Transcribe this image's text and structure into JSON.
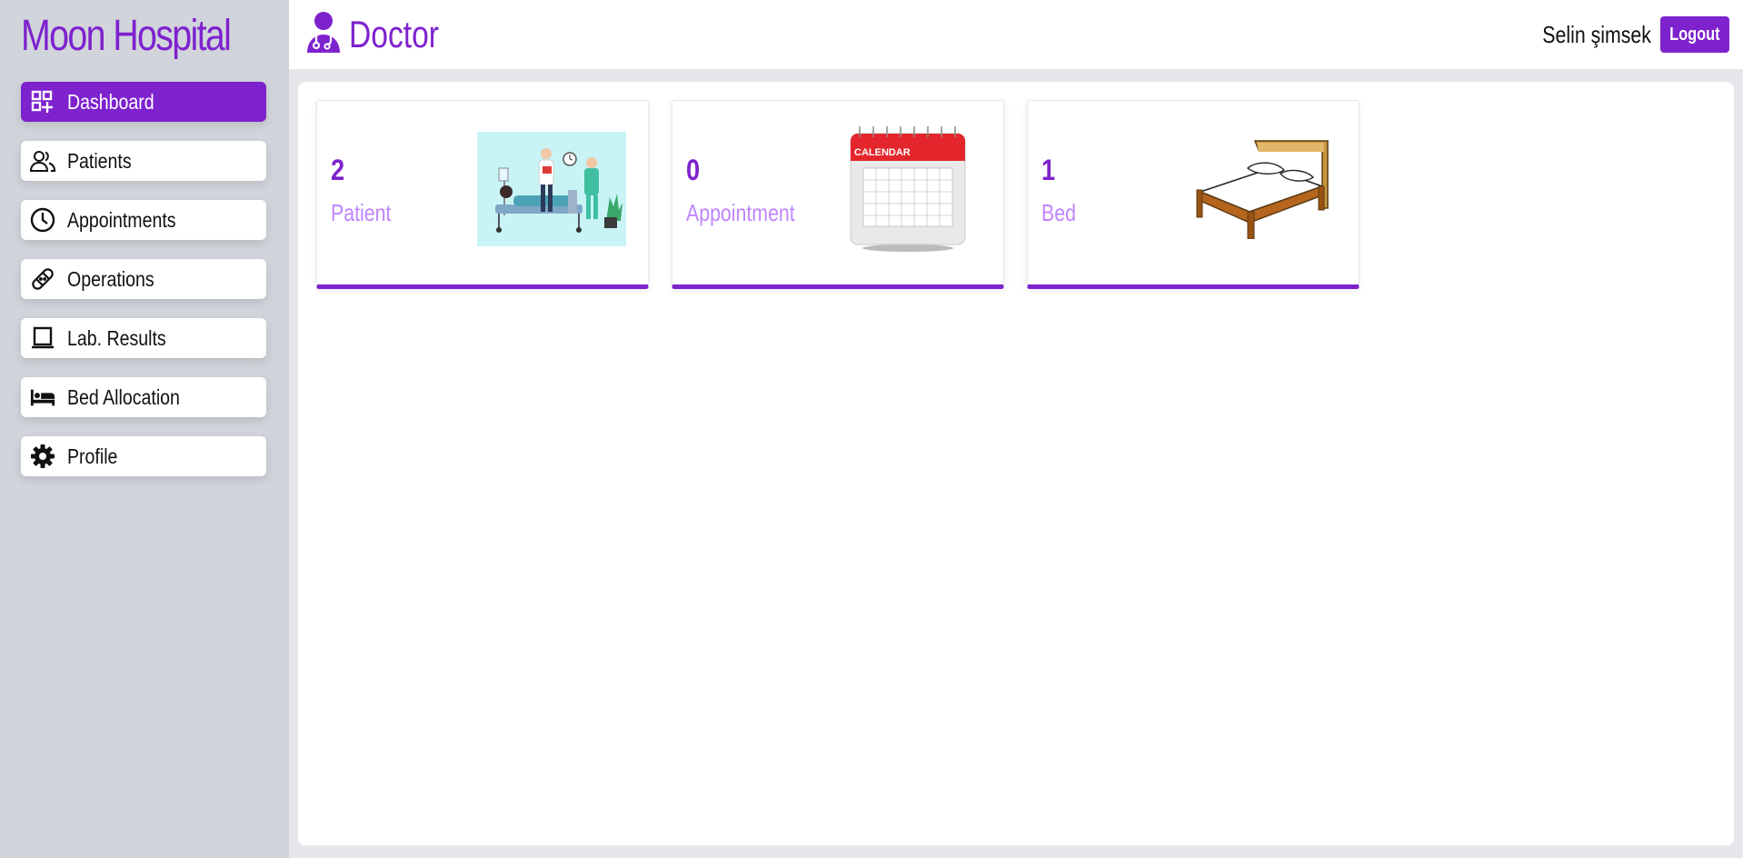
{
  "app": {
    "brand": "Moon Hospital",
    "accent_color": "#7e22ce",
    "label_color": "#c084fc"
  },
  "sidebar": {
    "items": [
      {
        "label": "Dashboard",
        "icon": "dashboard-grid-icon",
        "active": true
      },
      {
        "label": "Patients",
        "icon": "users-icon",
        "active": false
      },
      {
        "label": "Appointments",
        "icon": "clock-icon",
        "active": false
      },
      {
        "label": "Operations",
        "icon": "bandage-icon",
        "active": false
      },
      {
        "label": "Lab. Results",
        "icon": "laptop-icon",
        "active": false
      },
      {
        "label": "Bed Allocation",
        "icon": "bed-icon",
        "active": false
      },
      {
        "label": "Profile",
        "icon": "gear-icon",
        "active": false
      }
    ]
  },
  "header": {
    "title": "Doctor",
    "icon": "doctor-icon",
    "user_name": "Selin şimsek",
    "logout_label": "Logout"
  },
  "cards": [
    {
      "count": "2",
      "label": "Patient",
      "image": "hospital-illustration"
    },
    {
      "count": "0",
      "label": "Appointment",
      "image": "calendar-illustration",
      "calendar_caption": "CALENDAR"
    },
    {
      "count": "1",
      "label": "Bed",
      "image": "bed-illustration"
    }
  ]
}
